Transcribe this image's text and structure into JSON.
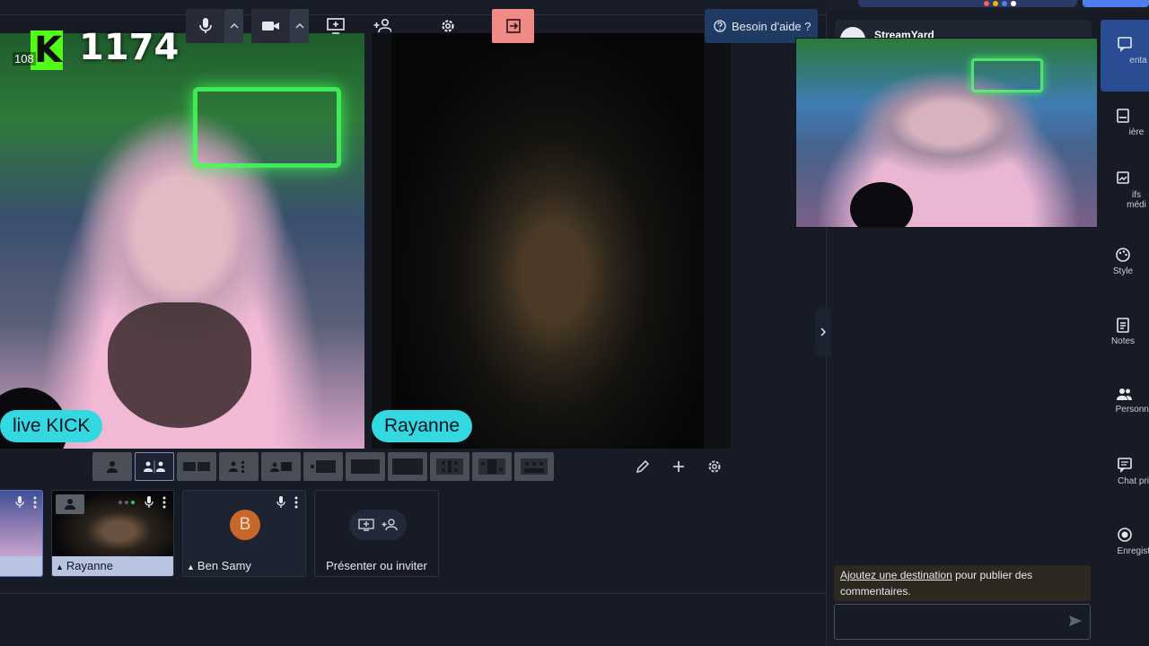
{
  "stage": {
    "left_tile": {
      "kick_letter": "K",
      "counter": "1174",
      "counter_small": "108",
      "name": "live KICK"
    },
    "center_tile": {
      "name": "Rayanne"
    }
  },
  "layout_bar": {
    "layouts": [
      "solo",
      "side-by-side",
      "group-small",
      "group-grid",
      "leader",
      "thin-leader",
      "pip-left",
      "pip-full",
      "fullscreen",
      "split-grid",
      "news",
      "cinema"
    ]
  },
  "participants": [
    {
      "name": "Rayanne"
    },
    {
      "name": "Ben Samy",
      "initial": "B"
    }
  ],
  "present_card": {
    "label": "Présenter ou inviter"
  },
  "bottom_bar": {
    "help_label": "Besoin d'aide ?"
  },
  "side": {
    "comment_author": "StreamYard",
    "notice_link": "Ajoutez une destination",
    "notice_text": " pour publier des commentaires.",
    "chat_placeholder": ""
  },
  "rail": {
    "items": [
      {
        "label": "Commentaires",
        "icon": "comment-icon"
      },
      {
        "label": "Bannières",
        "icon": "banner-icon"
      },
      {
        "label": "Fichiers média",
        "icon": "media-icon"
      },
      {
        "label": "Style",
        "icon": "palette-icon"
      },
      {
        "label": "Notes",
        "icon": "notes-icon"
      },
      {
        "label": "Personnes",
        "icon": "people-icon"
      },
      {
        "label": "Chat privé",
        "icon": "chat-icon"
      },
      {
        "label": "Enregistrements",
        "icon": "record-icon"
      }
    ],
    "visible_labels": [
      "enta",
      "ière",
      "ifs",
      "médi",
      "Style",
      "Notes",
      "Personne",
      "Chat priv",
      "Enregistren"
    ]
  },
  "colors": {
    "accent": "#33d8e0",
    "leave": "#f08a87",
    "help": "#1f3a63",
    "active_rail": "#2a4c93",
    "kick_green": "#53fc18"
  }
}
